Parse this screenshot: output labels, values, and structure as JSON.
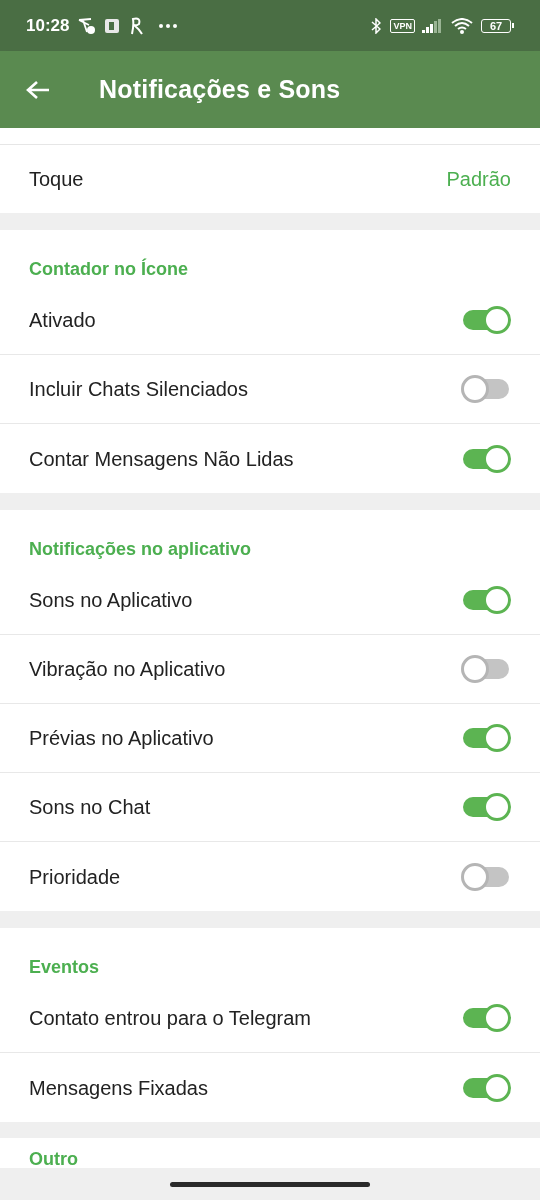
{
  "status_bar": {
    "time": "10:28",
    "vpn": "VPN",
    "battery": "67"
  },
  "toolbar": {
    "title": "Notificações e Sons"
  },
  "top_row": {
    "label": "Toque",
    "value": "Padrão"
  },
  "sections": [
    {
      "title": "Contador no Ícone",
      "rows": [
        {
          "label": "Ativado",
          "on": true
        },
        {
          "label": "Incluir Chats Silenciados",
          "on": false
        },
        {
          "label": "Contar Mensagens Não Lidas",
          "on": true
        }
      ]
    },
    {
      "title": "Notificações no aplicativo",
      "rows": [
        {
          "label": "Sons no Aplicativo",
          "on": true
        },
        {
          "label": "Vibração no Aplicativo",
          "on": false
        },
        {
          "label": "Prévias no Aplicativo",
          "on": true
        },
        {
          "label": "Sons no Chat",
          "on": true
        },
        {
          "label": "Prioridade",
          "on": false
        }
      ]
    },
    {
      "title": "Eventos",
      "rows": [
        {
          "label": "Contato entrou para o Telegram",
          "on": true
        },
        {
          "label": "Mensagens Fixadas",
          "on": true
        }
      ]
    }
  ],
  "next_section": {
    "title": "Outro"
  }
}
